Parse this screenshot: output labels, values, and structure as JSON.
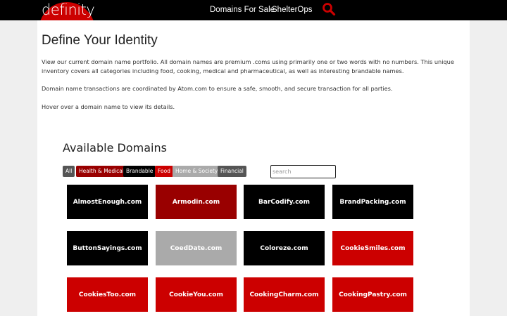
{
  "header": {
    "logo_text": "definity",
    "nav": [
      "Domains For Sale",
      "ShelterOps"
    ],
    "search_icon": "search-icon",
    "colors": {
      "bar": "#000000",
      "accent": "#cc0000"
    }
  },
  "main": {
    "title": "Define Your Identity",
    "paragraphs": [
      "View our current domain name portfolio. All domain names are premium .coms using primarily one or two words with no numbers. This unique inventory covers all categories including food, cooking, medical and pharmaceutical, as well as interesting brandable names.",
      "Domain name transactions are coordinated by Atom.com to ensure a safe, smooth, and secure transaction for all parties.",
      "Hover over a domain name to view its details."
    ],
    "available_title": "Available Domains",
    "filters": [
      {
        "label": "All",
        "color": "#555555"
      },
      {
        "label": "Health & Medical",
        "color": "#990000"
      },
      {
        "label": "Brandable",
        "color": "#000000"
      },
      {
        "label": "Food",
        "color": "#cc0000"
      },
      {
        "label": "Home & Society",
        "color": "#aaaaaa"
      },
      {
        "label": "Financial",
        "color": "#555555"
      }
    ],
    "search_placeholder": "search",
    "domains": [
      {
        "name": "AlmostEnough.com",
        "color": "#000000"
      },
      {
        "name": "Armodin.com",
        "color": "#990000"
      },
      {
        "name": "BarCodify.com",
        "color": "#000000"
      },
      {
        "name": "BrandPacking.com",
        "color": "#000000"
      },
      {
        "name": "ButtonSayings.com",
        "color": "#000000"
      },
      {
        "name": "CoedDate.com",
        "color": "#aaaaaa"
      },
      {
        "name": "Coloreze.com",
        "color": "#000000"
      },
      {
        "name": "CookieSmiles.com",
        "color": "#cc0000"
      },
      {
        "name": "CookiesToo.com",
        "color": "#cc0000"
      },
      {
        "name": "CookieYou.com",
        "color": "#cc0000"
      },
      {
        "name": "CookingCharm.com",
        "color": "#cc0000"
      },
      {
        "name": "CookingPastry.com",
        "color": "#cc0000"
      }
    ]
  }
}
